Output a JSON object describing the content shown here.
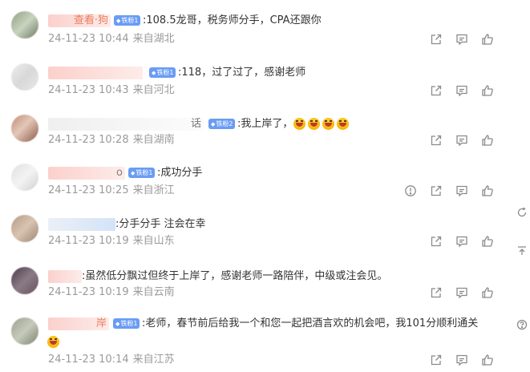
{
  "comments": [
    {
      "name": "查看·狗",
      "badge": "铁粉1",
      "text": ":108.5龙哥，税务师分手，CPA还跟你",
      "time": "24-11-23 10:44",
      "source": "来自湖北",
      "actions": [
        "share-icon",
        "comment-icon",
        "like-icon"
      ]
    },
    {
      "name": "",
      "badge": "铁粉1",
      "text": ":118，过了过了，感谢老师",
      "time": "24-11-23 10:43",
      "source": "来自河北",
      "actions": [
        "share-icon",
        "comment-icon",
        "like-icon"
      ]
    },
    {
      "name": "话",
      "badge": "铁粉2",
      "text": ":我上岸了，",
      "emoji_count": 4,
      "time": "24-11-23 10:28",
      "source": "来自湖南",
      "actions": [
        "share-icon",
        "comment-icon",
        "like-icon"
      ]
    },
    {
      "name": "o",
      "badge": "铁粉1",
      "text": ":成功分手",
      "time": "24-11-23 10:25",
      "source": "来自浙江",
      "actions": [
        "report-icon",
        "share-icon",
        "comment-icon",
        "like-icon"
      ]
    },
    {
      "name": "",
      "badge": "",
      "text": ":分手分手  注会在幸",
      "time": "24-11-23 10:19",
      "source": "来自山东",
      "actions": [
        "share-icon",
        "comment-icon",
        "like-icon"
      ]
    },
    {
      "name": "",
      "badge": "",
      "text": ":虽然低分飘过但终于上岸了，感谢老师一路陪伴，中级或注会见。",
      "time": "24-11-23 10:19",
      "source": "来自云南",
      "actions": [
        "share-icon",
        "comment-icon",
        "like-icon"
      ]
    },
    {
      "name": "岸",
      "badge": "铁粉1",
      "text": ":老师，春节前后给我一个和您一起把酒言欢的机会吧，我101分顺利通关",
      "emoji_count": 1,
      "time": "24-11-23 10:14",
      "source": "来自江苏",
      "actions": [
        "share-icon",
        "comment-icon",
        "like-icon"
      ]
    }
  ],
  "sidebar": [
    "refresh-icon",
    "back-to-top-icon",
    "feedback-icon"
  ],
  "colors": {
    "name": "#eb7350",
    "badge": "#6a9cf4",
    "text": "#333333",
    "meta": "#9a9a9a",
    "icon": "#8a8a8a"
  }
}
